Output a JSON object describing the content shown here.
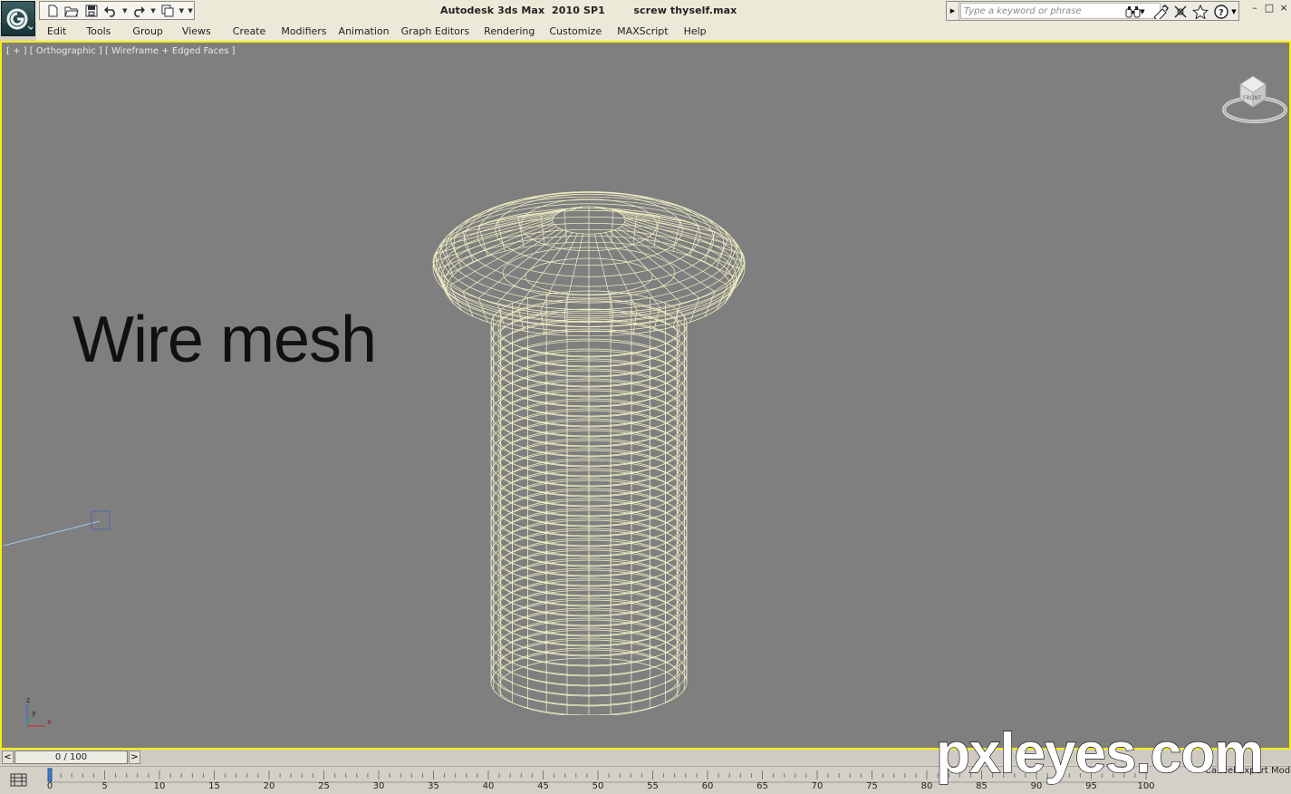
{
  "title_bar": {
    "app_name": "Autodesk 3ds Max  2010 SP1",
    "file_name": "screw thyself.max",
    "search_placeholder": "Type a keyword or phrase",
    "quick_access_icons": [
      "new-file-icon",
      "open-folder-icon",
      "save-icon",
      "undo-icon",
      "redo-icon",
      "project-folder-icon"
    ],
    "toolbar_icons": [
      "binoculars-search-icon",
      "communication-center-icon",
      "favorites-star-icon",
      "help-icon"
    ],
    "window_controls": [
      "–",
      "□",
      "×"
    ]
  },
  "menu": [
    "Edit",
    "Tools",
    "Group",
    "Views",
    "Create",
    "Modifiers",
    "Animation",
    "Graph Editors",
    "Rendering",
    "Customize",
    "MAXScript",
    "Help"
  ],
  "viewport": {
    "label": "[ + ] [ Orthographic ] [ Wireframe + Edged Faces ]",
    "annotation": "Wire mesh",
    "viewcube_face": "FRONT",
    "axis_labels": {
      "z": "z",
      "y": "y",
      "x": "x"
    },
    "border_color": "#f4ef00",
    "background_color": "#7f7f7f",
    "wire_color": "#f3f2c6"
  },
  "time_slider": {
    "prev": "<",
    "next": ">",
    "position": "0 / 100",
    "current_frame": 0,
    "total_frames": 100
  },
  "track_bar": {
    "tick_labels": [
      "0",
      "5",
      "10",
      "15",
      "20",
      "25",
      "30",
      "35",
      "40",
      "45",
      "50",
      "55",
      "60",
      "65",
      "70",
      "75",
      "80",
      "85",
      "90",
      "95",
      "100"
    ],
    "cancel_expert_mode": "Cancel Expert Mode"
  },
  "watermark": "pxleyes.com"
}
